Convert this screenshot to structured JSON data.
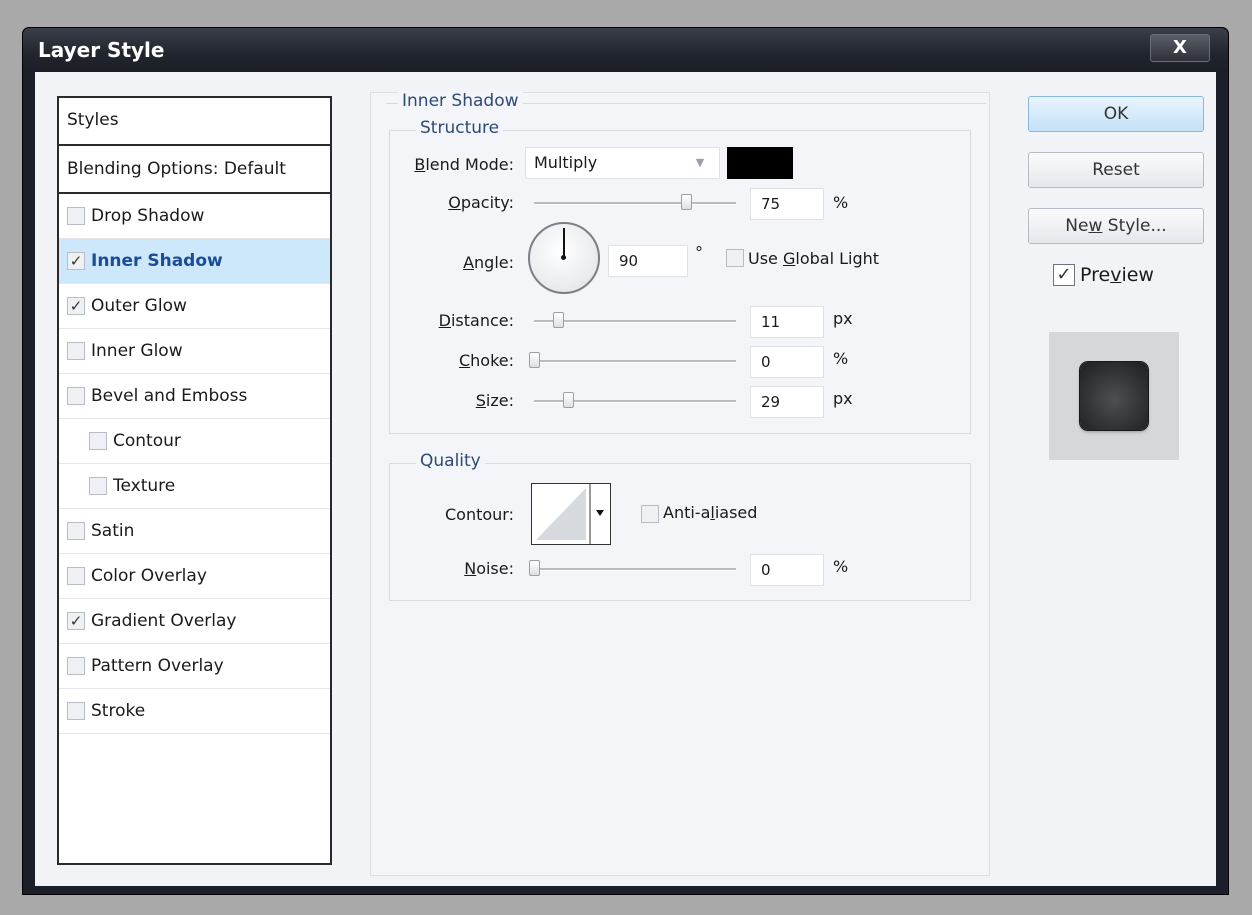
{
  "window": {
    "title": "Layer Style",
    "close_label": "X"
  },
  "styles_panel": {
    "header": "Styles",
    "blending": "Blending Options: Default",
    "items": [
      {
        "label": "Drop Shadow",
        "checked": false,
        "selected": false,
        "indent": false
      },
      {
        "label": "Inner Shadow",
        "checked": true,
        "selected": true,
        "indent": false
      },
      {
        "label": "Outer Glow",
        "checked": true,
        "selected": false,
        "indent": false
      },
      {
        "label": "Inner Glow",
        "checked": false,
        "selected": false,
        "indent": false
      },
      {
        "label": "Bevel and Emboss",
        "checked": false,
        "selected": false,
        "indent": false
      },
      {
        "label": "Contour",
        "checked": false,
        "selected": false,
        "indent": true
      },
      {
        "label": "Texture",
        "checked": false,
        "selected": false,
        "indent": true
      },
      {
        "label": "Satin",
        "checked": false,
        "selected": false,
        "indent": false
      },
      {
        "label": "Color Overlay",
        "checked": false,
        "selected": false,
        "indent": false
      },
      {
        "label": "Gradient Overlay",
        "checked": true,
        "selected": false,
        "indent": false
      },
      {
        "label": "Pattern Overlay",
        "checked": false,
        "selected": false,
        "indent": false
      },
      {
        "label": "Stroke",
        "checked": false,
        "selected": false,
        "indent": false
      }
    ]
  },
  "inner_shadow": {
    "title": "Inner Shadow",
    "structure": {
      "title": "Structure",
      "blend_mode_label_u": "B",
      "blend_mode_label_rest": "lend Mode:",
      "blend_mode_value": "Multiply",
      "shadow_color": "#000000",
      "opacity_label_u": "O",
      "opacity_label_rest": "pacity:",
      "opacity_value": "75",
      "opacity_unit": "%",
      "opacity_fraction": 0.75,
      "angle_label_u": "A",
      "angle_label_rest": "ngle:",
      "angle_value": "90",
      "angle_unit": "°",
      "use_global_light_pre": "Use ",
      "use_global_light_u": "G",
      "use_global_light_rest": "lobal Light",
      "use_global_light_checked": false,
      "distance_label_u": "D",
      "distance_label_rest": "istance:",
      "distance_value": "11",
      "distance_unit": "px",
      "choke_label_u": "C",
      "choke_label_rest": "hoke:",
      "choke_value": "0",
      "choke_unit": "%",
      "size_label_u": "S",
      "size_label_rest": "ize:",
      "size_value": "29",
      "size_unit": "px"
    },
    "quality": {
      "title": "Quality",
      "contour_label": "Contour:",
      "anti_aliased_pre": "Anti-a",
      "anti_aliased_u": "l",
      "anti_aliased_rest": "iased",
      "anti_aliased_checked": false,
      "noise_label_u": "N",
      "noise_label_rest": "oise:",
      "noise_value": "0",
      "noise_unit": "%"
    }
  },
  "buttons": {
    "ok": "OK",
    "reset": "Reset",
    "new_style_pre": "Ne",
    "new_style_u": "w",
    "new_style_rest": " Style...",
    "preview_pre": "Pre",
    "preview_u": "v",
    "preview_rest": "iew",
    "preview_checked": true
  }
}
